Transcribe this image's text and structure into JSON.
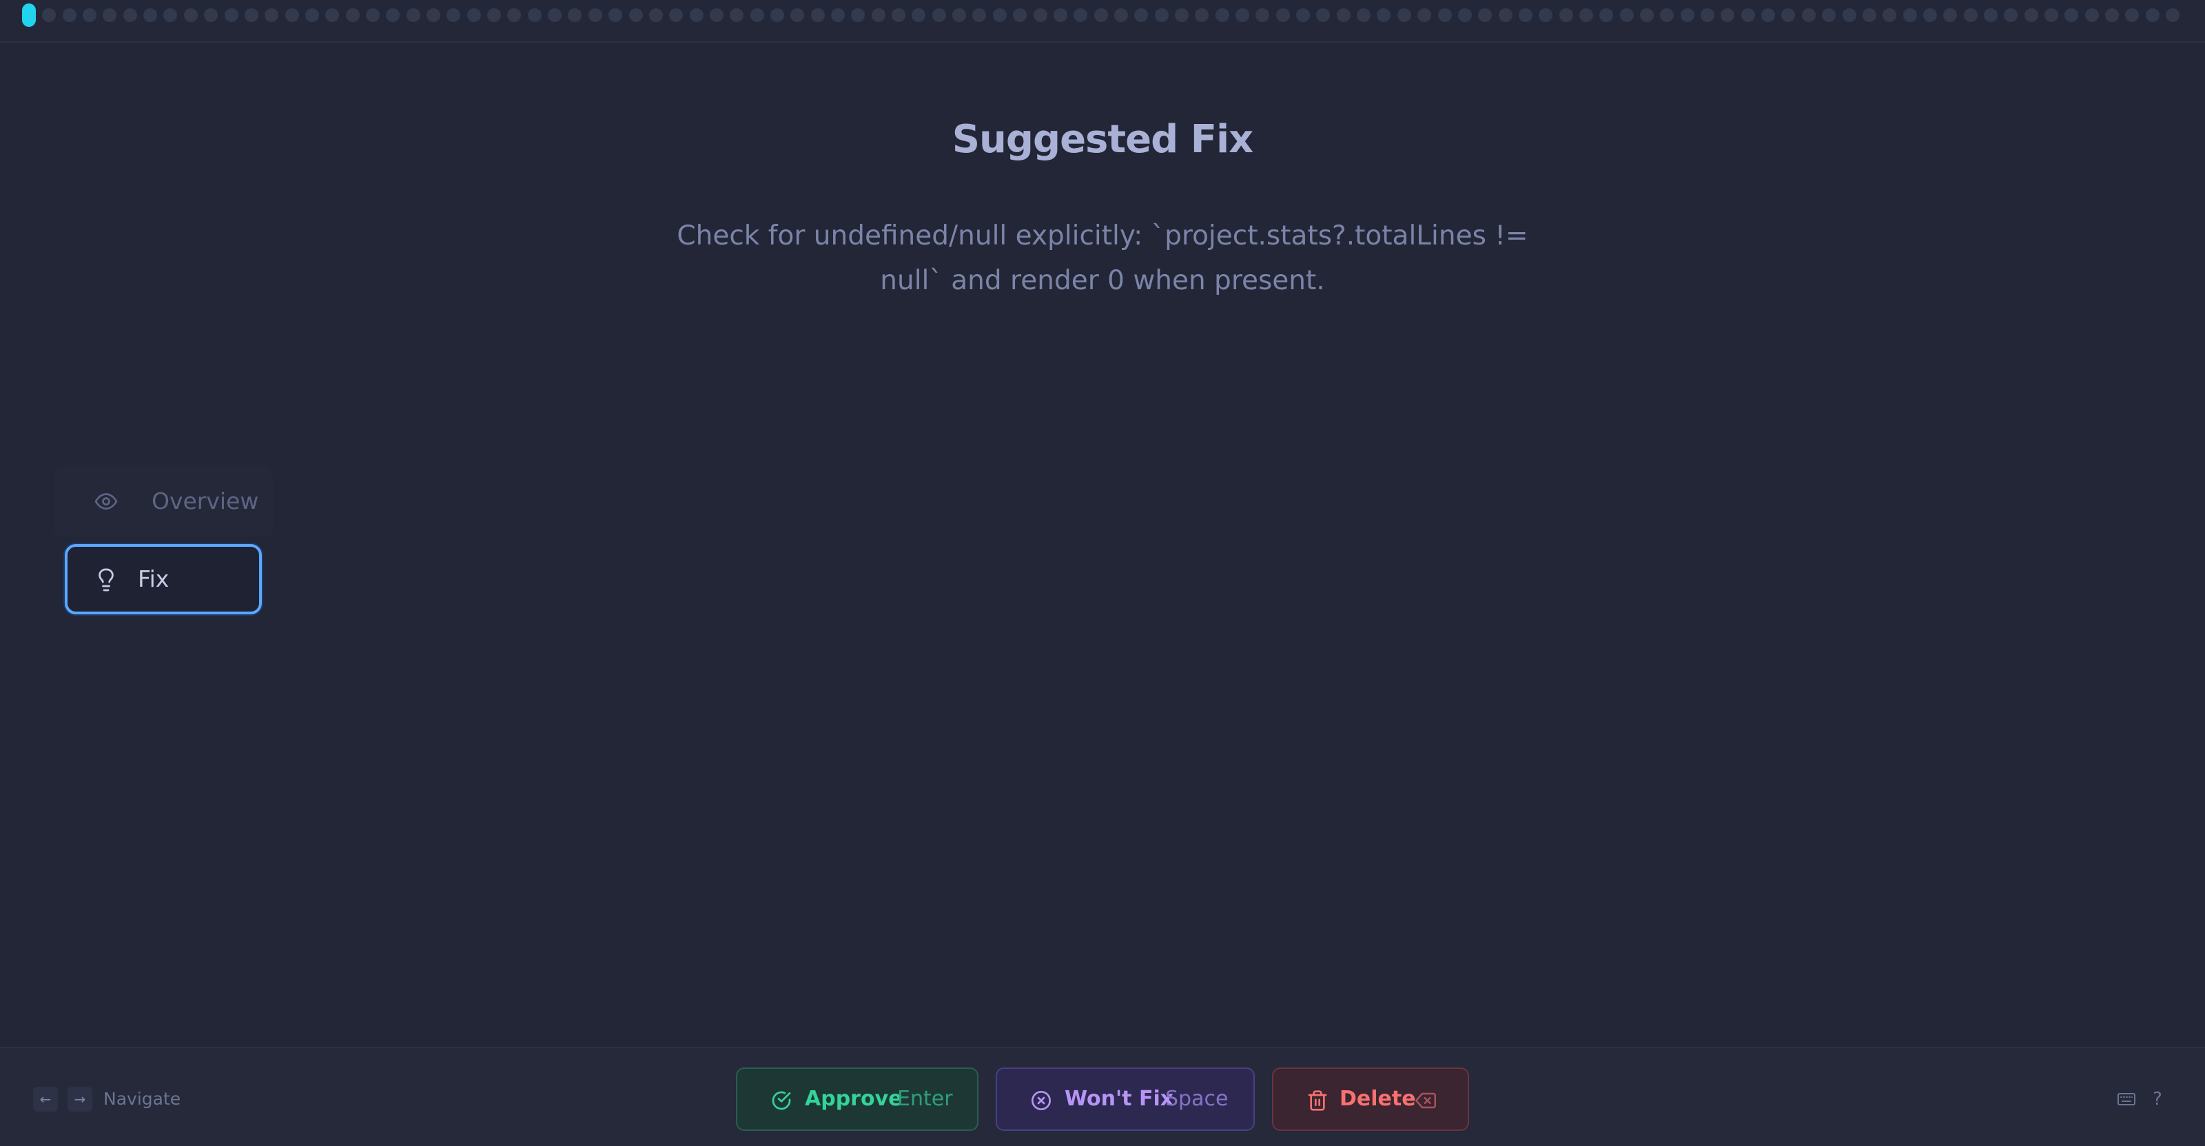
{
  "progress": {
    "total": 107,
    "current": 1
  },
  "main": {
    "title": "Suggested Fix",
    "description": "Check for undefined/null explicitly: `project.stats?.totalLines != null` and render 0 when present."
  },
  "side_nav": {
    "items": [
      {
        "label": "Overview",
        "icon": "eye-icon",
        "active": false
      },
      {
        "label": "Fix",
        "icon": "lightbulb-icon",
        "active": true
      }
    ]
  },
  "bottom_bar": {
    "nav_left_key": "←",
    "nav_right_key": "→",
    "navigate_label": "Navigate",
    "approve": {
      "label": "Approve",
      "hint": "Enter",
      "icon": "check-circle-icon"
    },
    "wont_fix": {
      "label": "Won't Fix",
      "hint": "Space",
      "icon": "x-circle-icon"
    },
    "delete": {
      "label": "Delete",
      "hint_icon": "backspace-icon",
      "icon": "trash-icon"
    },
    "keyboard_icon": "keyboard-icon",
    "help_label": "?"
  },
  "colors": {
    "background": "#222636",
    "accent_active": "#22d3ee",
    "approve": "#34d399",
    "wont_fix": "#b794f6",
    "delete": "#f87171",
    "focus_ring": "#5ba7ff"
  }
}
